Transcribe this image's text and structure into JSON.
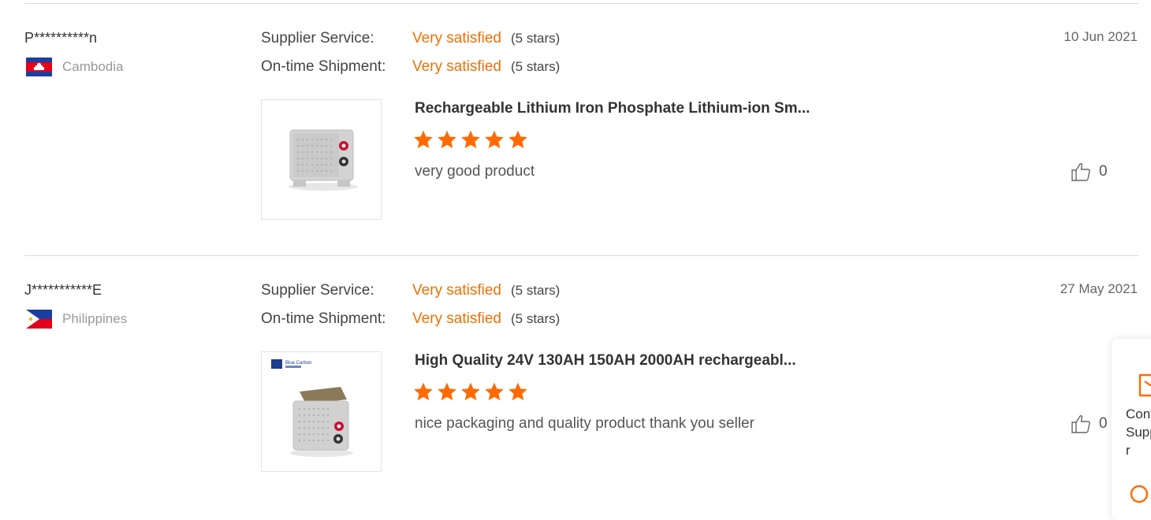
{
  "labels": {
    "supplier_service": "Supplier Service:",
    "ontime_shipment": "On-time Shipment:"
  },
  "reviews": [
    {
      "user": "P**********n",
      "country": "Cambodia",
      "flag": "cambodia-flag",
      "date": "10 Jun 2021",
      "supplier_service": "Very satisfied",
      "supplier_service_stars": "(5 stars)",
      "ontime_shipment": "Very satisfied",
      "ontime_shipment_stars": "(5 stars)",
      "product_title": "Rechargeable Lithium Iron Phosphate Lithium-ion Sm...",
      "rating": 5,
      "comment": "very good product",
      "likes": "0"
    },
    {
      "user": "J***********E",
      "country": "Philippines",
      "flag": "philippines-flag",
      "date": "27 May 2021",
      "supplier_service": "Very satisfied",
      "supplier_service_stars": "(5 stars)",
      "ontime_shipment": "Very satisfied",
      "ontime_shipment_stars": "(5 stars)",
      "product_title": "High Quality 24V 130AH 150AH 2000AH rechargeabl...",
      "rating": 5,
      "comment": "nice packaging and quality product thank you seller",
      "likes": "0",
      "thumb_logo": "Blue Carbon"
    }
  ],
  "contact_panel": {
    "label": "Contact Supplier",
    "icon": "message-icon"
  },
  "colors": {
    "accent": "#f07000",
    "divider": "#dcdcdc",
    "star": "#ff6a00"
  }
}
